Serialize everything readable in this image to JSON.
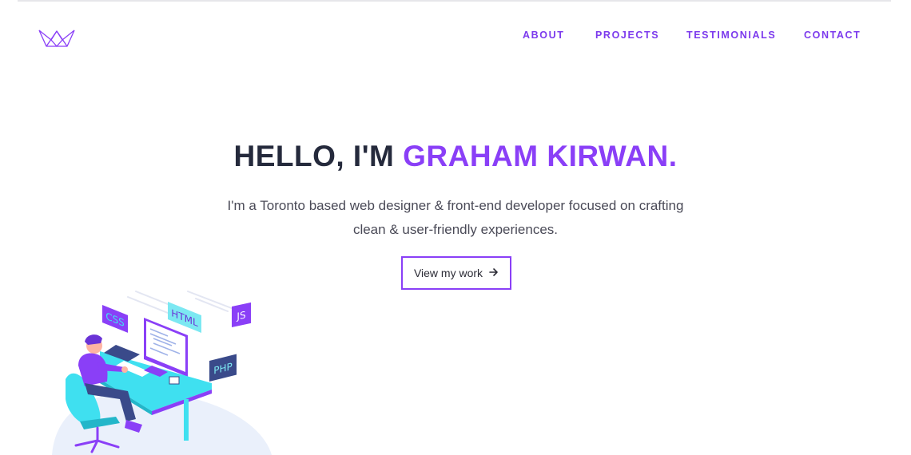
{
  "header": {
    "logo_name": "crown-logo",
    "nav": [
      {
        "label": "ABOUT"
      },
      {
        "label": "PROJECTS"
      },
      {
        "label": "TESTIMONIALS"
      },
      {
        "label": "CONTACT"
      }
    ]
  },
  "hero": {
    "title_prefix": "HELLO, I'M ",
    "title_name": "GRAHAM KIRWAN.",
    "subtitle": "I'm a Toronto based web designer & front-end developer focused on crafting clean & user-friendly experiences.",
    "cta_label": "View my work",
    "cta_icon": "arrow-right-icon"
  },
  "illustration": {
    "tags": [
      "CSS",
      "HTML",
      "JS",
      "PHP"
    ]
  },
  "colors": {
    "accent": "#8a3ff7",
    "nav": "#7c3aed",
    "heading": "#252a3c",
    "body_text": "#4a4a57",
    "cyan": "#3fe0f0"
  }
}
